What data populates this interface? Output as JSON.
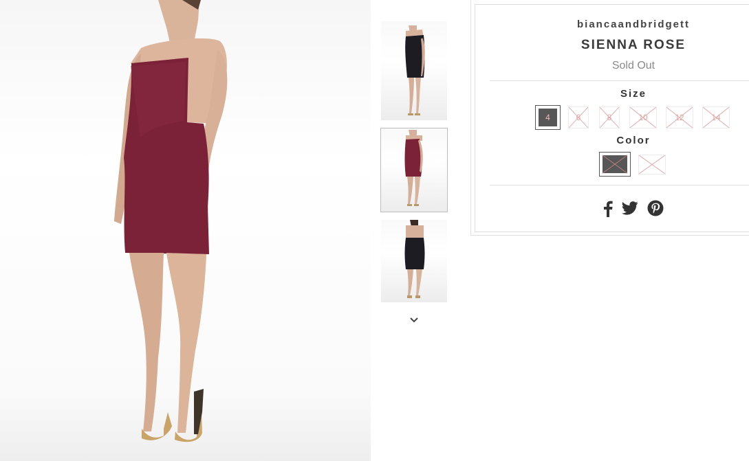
{
  "product": {
    "brand": "biancaandbridgett",
    "name": "SIENNA ROSE",
    "status": "Sold Out"
  },
  "options": {
    "size_label": "Size",
    "sizes": [
      "4",
      "6",
      "8",
      "10",
      "12",
      "14"
    ],
    "selected_size": "4",
    "color_label": "Color",
    "colors": [
      {
        "swatch": "#575757",
        "selected": true
      },
      {
        "swatch": "#ffffff",
        "selected": false
      }
    ]
  },
  "gallery": {
    "main_dress_color": "#7c2238",
    "thumbnails": [
      "black dress front",
      "burgundy dress side",
      "black dress back"
    ],
    "next_icon": "chevron-down-icon"
  },
  "share": {
    "icons": [
      "facebook-icon",
      "twitter-icon",
      "pinterest-icon"
    ]
  },
  "colors": {
    "unavailable_cross": "#e3a7a7",
    "text_dark": "#3a3a3a",
    "text_muted": "#8a8a8a",
    "border": "#dcdcdc"
  }
}
